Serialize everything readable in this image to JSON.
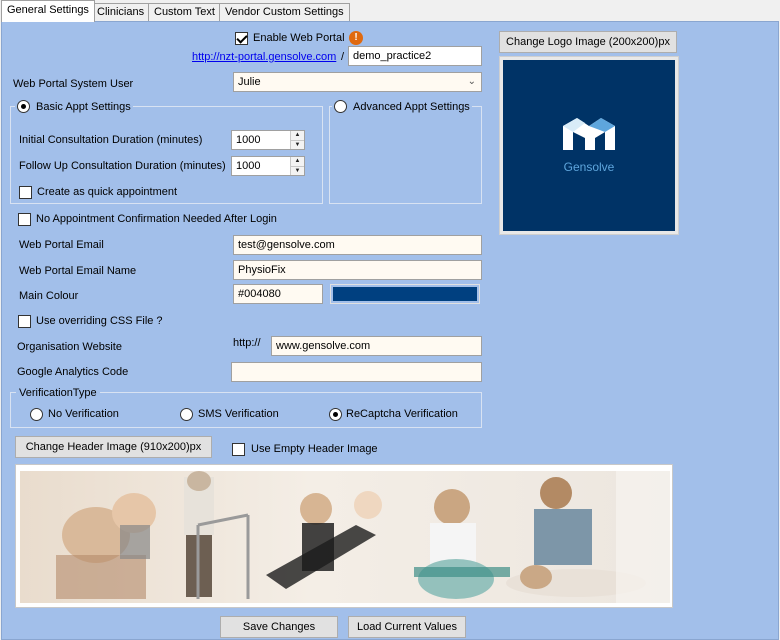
{
  "tabs": [
    {
      "label": "General Settings"
    },
    {
      "label": "Clinicians"
    },
    {
      "label": "Custom Text"
    },
    {
      "label": "Vendor Custom Settings"
    }
  ],
  "portal": {
    "enable_label": "Enable Web Portal",
    "enabled": true,
    "url_link": "http://nzt-portal.gensolve.com",
    "url_separator": "/",
    "practice_path": "demo_practice2",
    "warning_icon_glyph": "!"
  },
  "system_user": {
    "label": "Web Portal System User",
    "value": "Julie"
  },
  "appt": {
    "basic_label": "Basic Appt Settings",
    "advanced_label": "Advanced Appt Settings",
    "mode": "basic",
    "initial_label": "Initial Consultation Duration (minutes)",
    "initial_value": "1000",
    "followup_label": "Follow Up Consultation Duration (minutes)",
    "followup_value": "1000",
    "quick_label": "Create as quick appointment",
    "quick_checked": false
  },
  "no_confirm": {
    "label": "No Appointment Confirmation Needed After Login",
    "checked": false
  },
  "email": {
    "label": "Web Portal Email",
    "value": "test@gensolve.com",
    "name_label": "Web Portal Email Name",
    "name_value": "PhysioFix"
  },
  "main_colour": {
    "label": "Main Colour",
    "value": "#004080",
    "swatch": "#004080"
  },
  "css_override": {
    "label": "Use overriding CSS File ?",
    "checked": false
  },
  "website": {
    "label": "Organisation Website",
    "prefix": "http://",
    "value": "www.gensolve.com"
  },
  "analytics": {
    "label": "Google Analytics Code",
    "value": ""
  },
  "verification": {
    "title": "VerificationType",
    "options": [
      "No Verification",
      "SMS Verification",
      "ReCaptcha Verification"
    ],
    "selected": "ReCaptcha Verification"
  },
  "header_image": {
    "change_label": "Change Header Image (910x200)px",
    "empty_label": "Use Empty Header Image",
    "empty_checked": false
  },
  "logo": {
    "change_label": "Change Logo Image (200x200)px",
    "brand_text": "Gensolve",
    "background": "#003366"
  },
  "actions": {
    "save_label": "Save Changes",
    "load_label": "Load Current Values"
  },
  "colors": {
    "panel_bg": "#a2bfea",
    "link": "#0000ee",
    "logo_accent": "#5ea6dd",
    "warning": "#e06a10"
  }
}
